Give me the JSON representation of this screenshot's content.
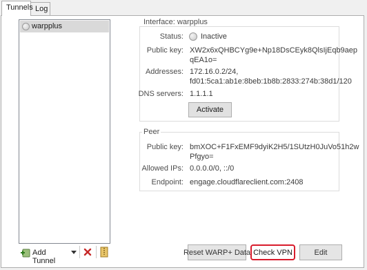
{
  "tabs": [
    {
      "label": "Tunnels"
    },
    {
      "label": "Log"
    }
  ],
  "tunnels": [
    {
      "name": "warpplus"
    }
  ],
  "interface": {
    "title": "Interface: warpplus",
    "status_label": "Status:",
    "status_value": "Inactive",
    "public_key_label": "Public key:",
    "public_key_line1": "XW2x6xQHBCYg9e+Np18DsCEyk8QlsIjEqb9aep",
    "public_key_line2": "qEA1o=",
    "addresses_label": "Addresses:",
    "addresses_line1": "172.16.0.2/24,",
    "addresses_line2": "fd01:5ca1:ab1e:8beb:1b8b:2833:274b:38d1/120",
    "dns_label": "DNS servers:",
    "dns_value": "1.1.1.1",
    "activate_button": "Activate"
  },
  "peer": {
    "title": "Peer",
    "public_key_label": "Public key:",
    "public_key_line1": "bmXOC+F1FxEMF9dyiK2H5/1SUtzH0JuVo51h2w",
    "public_key_line2": "Pfgyo=",
    "allowed_ips_label": "Allowed IPs:",
    "allowed_ips_value": "0.0.0.0/0, ::/0",
    "endpoint_label": "Endpoint:",
    "endpoint_value": "engage.cloudflareclient.com:2408"
  },
  "toolbar": {
    "add_tunnel_label": "Add Tunnel"
  },
  "buttons": {
    "reset": "Reset WARP+ Data",
    "check_vpn": "Check VPN",
    "edit": "Edit"
  },
  "icons": {
    "add_tunnel": "add-tunnel-icon",
    "dropdown": "dropdown-arrow-icon",
    "delete": "delete-icon",
    "export": "zip-export-icon"
  },
  "colors": {
    "focus_outline": "#d81b2b",
    "delete_icon": "#c62828",
    "selected_row": "#d9d9d9"
  }
}
